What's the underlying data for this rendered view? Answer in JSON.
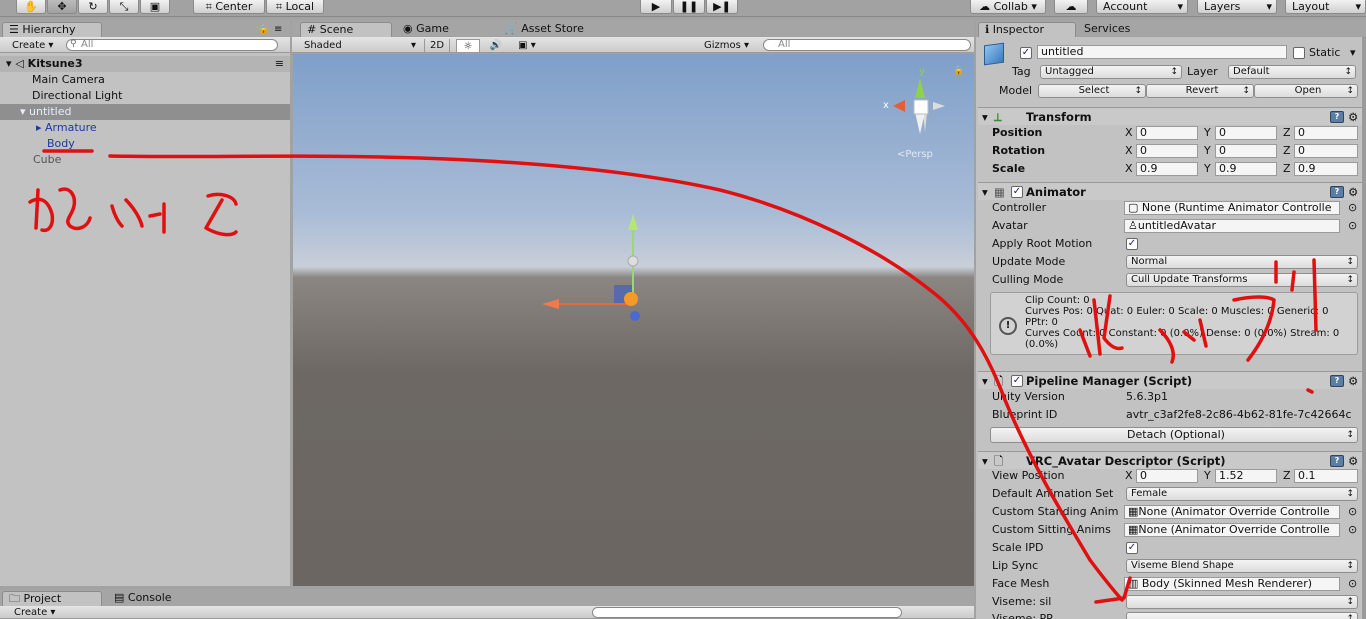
{
  "toolbar": {
    "pivot": "Center",
    "space": "Local",
    "collab": "Collab",
    "account": "Account",
    "layers": "Layers",
    "layout": "Layout"
  },
  "hierarchy": {
    "tab": "Hierarchy",
    "create": "Create",
    "search_placeholder": "All",
    "scene": "Kitsune3",
    "items": [
      {
        "label": "Main Camera"
      },
      {
        "label": "Directional Light"
      },
      {
        "label": "untitled"
      },
      {
        "label": "Armature"
      },
      {
        "label": "Body"
      },
      {
        "label": "Cube"
      }
    ]
  },
  "scene_view": {
    "tabs": [
      "Scene",
      "Game",
      "Asset Store"
    ],
    "shading": "Shaded",
    "mode_2d": "2D",
    "gizmos": "Gizmos",
    "search_placeholder": "All",
    "persp": "Persp",
    "axis_x": "x",
    "axis_y": "y"
  },
  "inspector": {
    "tabs": [
      "Inspector",
      "Services"
    ],
    "object_name": "untitled",
    "static": "Static",
    "tag_label": "Tag",
    "tag": "Untagged",
    "layer_label": "Layer",
    "layer": "Default",
    "model_label": "Model",
    "model_buttons": [
      "Select",
      "Revert",
      "Open"
    ],
    "transform": {
      "title": "Transform",
      "rows": [
        {
          "label": "Position",
          "x": "0",
          "y": "0",
          "z": "0"
        },
        {
          "label": "Rotation",
          "x": "0",
          "y": "0",
          "z": "0"
        },
        {
          "label": "Scale",
          "x": "0.9",
          "y": "0.9",
          "z": "0.9"
        }
      ]
    },
    "animator": {
      "title": "Animator",
      "controller_label": "Controller",
      "controller": "None (Runtime Animator Controlle",
      "avatar_label": "Avatar",
      "avatar": "untitledAvatar",
      "apply_root_motion": "Apply Root Motion",
      "update_mode_label": "Update Mode",
      "update_mode": "Normal",
      "culling_mode_label": "Culling Mode",
      "culling_mode": "Cull Update Transforms",
      "info_lines": [
        "Clip Count: 0",
        "Curves Pos: 0 Quat: 0 Euler: 0 Scale: 0 Muscles: 0 Generic: 0",
        "PPtr: 0",
        "Curves Count: 0 Constant: 0 (0.0%) Dense: 0 (0.0%) Stream: 0",
        "(0.0%)"
      ]
    },
    "pipeline": {
      "title": "Pipeline Manager (Script)",
      "unity_version_label": "Unity Version",
      "unity_version": "5.6.3p1",
      "blueprint_label": "Blueprint ID",
      "blueprint": "avtr_c3af2fe8-2c86-4b62-81fe-7c42664c",
      "detach": "Detach (Optional)"
    },
    "descriptor": {
      "title": "VRC_Avatar Descriptor (Script)",
      "view_position_label": "View Position",
      "view_x": "0",
      "view_y": "1.52",
      "view_z": "0.1",
      "default_anim_label": "Default Animation Set",
      "default_anim": "Female",
      "standing_label": "Custom Standing Anim",
      "standing": "None (Animator Override Controlle",
      "sitting_label": "Custom Sitting Anims",
      "sitting": "None (Animator Override Controlle",
      "scale_ipd_label": "Scale IPD",
      "lip_sync_label": "Lip Sync",
      "lip_sync": "Viseme Blend Shape",
      "face_mesh_label": "Face Mesh",
      "face_mesh": "Body (Skinned Mesh Renderer)",
      "viseme_sil_label": "Viseme: sil",
      "viseme_pp_label": "Viseme: PP"
    }
  },
  "bottom": {
    "tabs": [
      "Project",
      "Console"
    ],
    "create": "Create"
  },
  "annotations": {
    "color": "#e01010"
  },
  "colors": {
    "selection": "#3d60c8",
    "prefab_text": "#1b3aa0",
    "sky_top": "#7f9fc9",
    "ground": "#6d6864"
  }
}
